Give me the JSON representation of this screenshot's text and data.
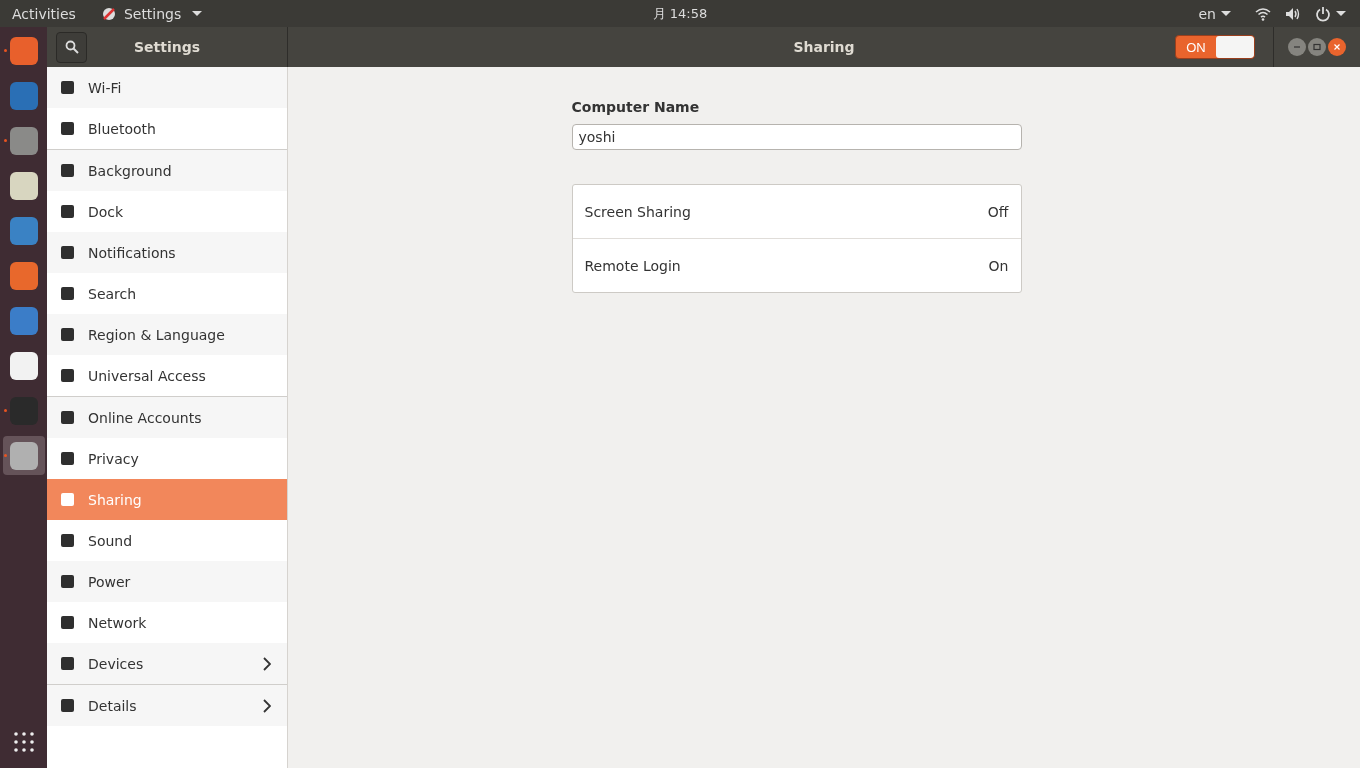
{
  "top_bar": {
    "activities": "Activities",
    "app_menu": "Settings",
    "clock": "月 14:58",
    "language": "en"
  },
  "dock": [
    {
      "running": true,
      "selected": false
    },
    {
      "running": false,
      "selected": false
    },
    {
      "running": true,
      "selected": false
    },
    {
      "running": false,
      "selected": false
    },
    {
      "running": false,
      "selected": false
    },
    {
      "running": false,
      "selected": false
    },
    {
      "running": false,
      "selected": false
    },
    {
      "running": false,
      "selected": false
    },
    {
      "running": true,
      "selected": false
    },
    {
      "running": true,
      "selected": true
    }
  ],
  "header": {
    "sidebar_title": "Settings",
    "title": "Sharing",
    "switch": {
      "label": "ON",
      "on": true
    }
  },
  "sidebar": {
    "sections": [
      [
        {
          "label": "Wi-Fi",
          "selected": false,
          "has_arrow": false
        },
        {
          "label": "Bluetooth",
          "selected": false,
          "has_arrow": false
        }
      ],
      [
        {
          "label": "Background",
          "selected": false,
          "has_arrow": false
        },
        {
          "label": "Dock",
          "selected": false,
          "has_arrow": false
        },
        {
          "label": "Notifications",
          "selected": false,
          "has_arrow": false
        },
        {
          "label": "Search",
          "selected": false,
          "has_arrow": false
        },
        {
          "label": "Region & Language",
          "selected": false,
          "has_arrow": false
        },
        {
          "label": "Universal Access",
          "selected": false,
          "has_arrow": false
        }
      ],
      [
        {
          "label": "Online Accounts",
          "selected": false,
          "has_arrow": false
        },
        {
          "label": "Privacy",
          "selected": false,
          "has_arrow": false
        },
        {
          "label": "Sharing",
          "selected": true,
          "has_arrow": false
        },
        {
          "label": "Sound",
          "selected": false,
          "has_arrow": false
        },
        {
          "label": "Power",
          "selected": false,
          "has_arrow": false
        },
        {
          "label": "Network",
          "selected": false,
          "has_arrow": false
        },
        {
          "label": "Devices",
          "selected": false,
          "has_arrow": true
        }
      ],
      [
        {
          "label": "Details",
          "selected": false,
          "has_arrow": true
        }
      ]
    ]
  },
  "content": {
    "name_label": "Computer Name",
    "name_value": "yoshi",
    "services": [
      {
        "name": "Screen Sharing",
        "status": "Off"
      },
      {
        "name": "Remote Login",
        "status": "On"
      }
    ]
  }
}
